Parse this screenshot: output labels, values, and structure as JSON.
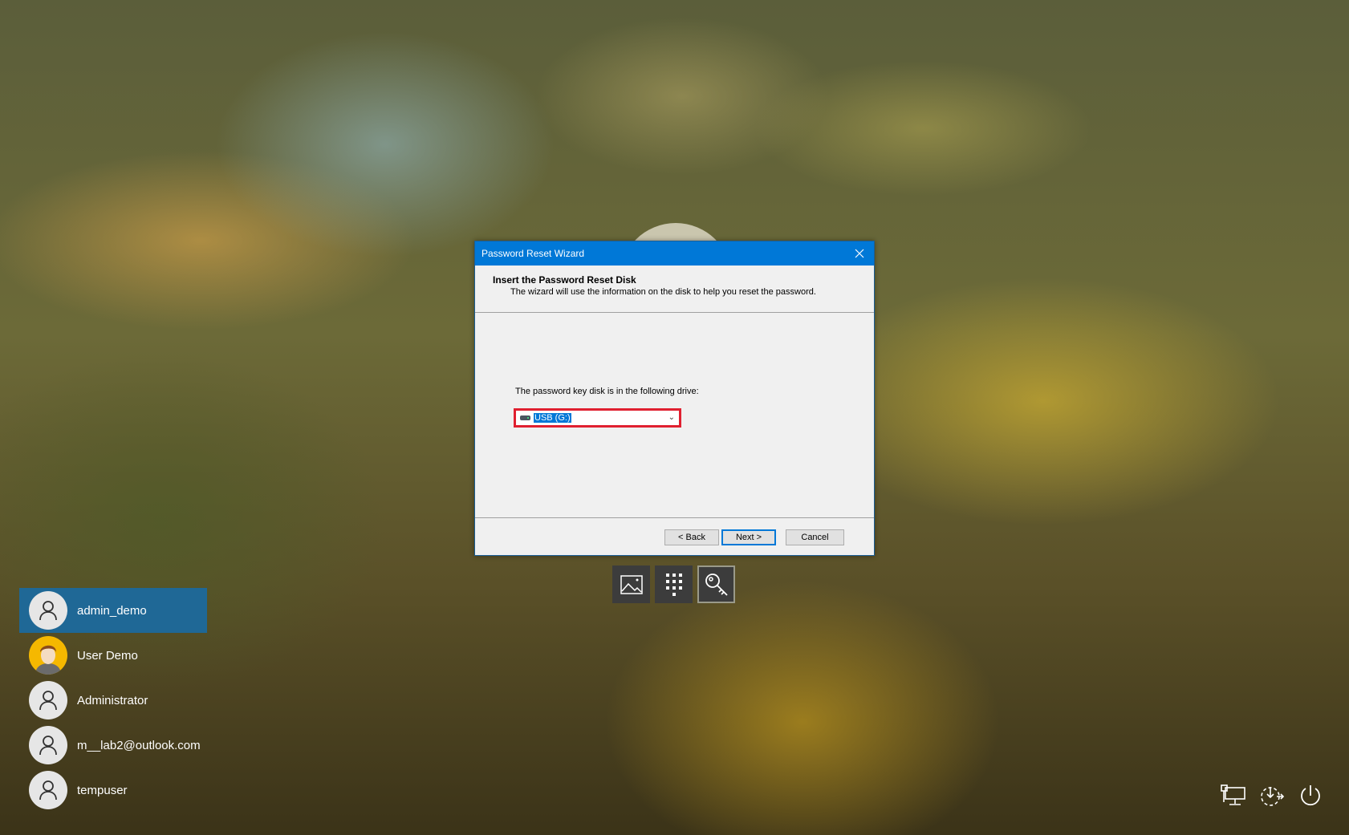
{
  "dialog": {
    "title": "Password Reset Wizard",
    "header_title": "Insert the Password Reset Disk",
    "header_subtitle": "The wizard will use the information on the disk to help you reset the password.",
    "drive_label": "The password key disk is in the following drive:",
    "drive_selected": "USB (G:)",
    "buttons": {
      "back": "< Back",
      "next": "Next >",
      "cancel": "Cancel"
    }
  },
  "sign_in_options": [
    {
      "icon": "picture-password-icon"
    },
    {
      "icon": "pin-keypad-icon"
    },
    {
      "icon": "security-key-icon",
      "selected": true
    }
  ],
  "users": [
    {
      "name": "admin_demo",
      "selected": true
    },
    {
      "name": "User Demo"
    },
    {
      "name": "Administrator"
    },
    {
      "name": "m__lab2@outlook.com"
    },
    {
      "name": "tempuser"
    }
  ],
  "system_icons": [
    "network-icon",
    "ease-of-access-icon",
    "power-icon"
  ],
  "colors": {
    "accent": "#0078d7",
    "highlight_border": "#e02030",
    "selected_user": "#1f6896"
  }
}
